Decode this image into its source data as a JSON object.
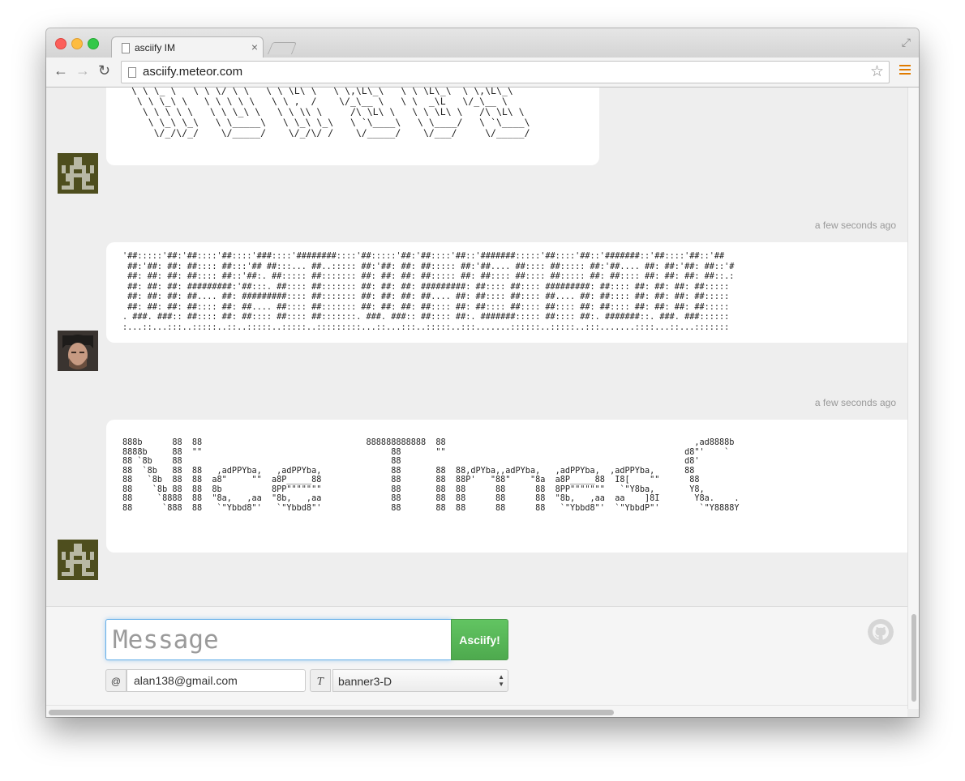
{
  "browser": {
    "tab_title": "asciify IM",
    "tab_close": "×",
    "url": "asciify.meteor.com",
    "back_glyph": "←",
    "forward_glyph": "→",
    "reload_glyph": "↻",
    "star_glyph": "☆",
    "fullscreen_glyph": "⤢",
    "icons": [
      "back-arrow-icon",
      "forward-arrow-icon",
      "reload-icon",
      "page-icon",
      "bookmark-star-icon",
      "chrome-menu-icon"
    ]
  },
  "messages": [
    {
      "avatar": "pixel-robot-avatar",
      "timestamp": "",
      "ascii": " \\ \\ \\_ \\   \\ \\ \\/ \\ \\   \\ \\ \\L\\ \\   \\ \\,\\L\\_\\   \\ \\ \\L\\_\\  \\ \\,\\L\\_\\\n  \\ \\ \\_\\ \\   \\ \\ \\ \\ \\   \\ \\ ,  /    \\/_\\__ \\   \\ \\  _\\L   \\/_\\__ \\\n   \\ \\ \\ \\ \\   \\ \\ \\_\\ \\   \\ \\ \\\\ \\     /\\ \\L\\ \\   \\ \\ \\L\\ \\   /\\ \\L\\ \\\n    \\ \\_\\ \\_\\   \\ \\_____\\   \\ \\_\\ \\_\\   \\ `\\____\\   \\ \\____/   \\ `\\____\\\n     \\/_/\\/_/    \\/_____/    \\/_/\\/ /    \\/_____/    \\/___/     \\/_____/"
    },
    {
      "avatar": "bearded-man-photo-avatar",
      "timestamp": "a few seconds ago",
      "ascii": "'##:::::'##:'##::::'##::::'###::::'########::::'##:::::'##:'##::::'##::'#######:::::'##::::'##::'#######::'##::::'##::'##\n ##:'##: ##: ##:::: ##:::'## ##:::... ##..::::: ##:'##: ##: ##::::: ##:'##.... ##:::: ##::::: ##:'##.... ##: ##:'##: ##::'#\n ##: ##: ##: ##:::: ##::'##:. ##::::: ##::::::: ##: ##: ##: ##::::: ##: ##:::: ##:::: ##::::: ##: ##:::: ##: ##: ##: ##::.:\n ##: ##: ##: #########:'##:::. ##:::: ##::::::: ##: ##: ##: #########: ##:::: ##:::: #########: ##:::: ##: ##: ##: ##:::::\n ##: ##: ##: ##.... ##: #########:::: ##::::::: ##: ##: ##: ##.... ##: ##:::: ##:::: ##.... ##: ##:::: ##: ##: ##: ##:::::\n ##: ##: ##: ##:::: ##: ##.... ##:::: ##::::::: ##: ##: ##: ##:::: ##: ##:::: ##:::: ##:::: ##: ##:::: ##: ##: ##: ##:::::\n. ###. ###:: ##:::: ##: ##:::: ##:::: ##:::::::. ###. ###:: ##:::: ##:. #######::::: ##:::: ##:. #######::. ###. ###::::::\n:...::...:::..:::::..::..:::::..:::::..:::::::::...::...:::..:::::..:::.......::::::..:::::..:::.......::::...::...:::::::"
    },
    {
      "avatar": "pixel-robot-avatar",
      "timestamp": "a few seconds ago",
      "ascii": "888b      88  88                                 888888888888  88                                                  ,ad8888b\n8888b     88  \"\"                                      88       \"\"                                                d8\"'    `\n88 `8b    88                                          88                                                         d8'\n88  `8b   88  88   ,adPPYba,   ,adPPYba,              88       88  88,dPYba,,adPYba,   ,adPPYba,  ,adPPYba,      88\n88   `8b  88  88  a8\"     \"\"  a8P_____88              88       88  88P'   \"88\"    \"8a  a8P_____88  I8[    \"\"      88\n88    `8b 88  88  8b          8PP\"\"\"\"\"\"\"              88       88  88      88      88  8PP\"\"\"\"\"\"\"   `\"Y8ba,       Y8,\n88     `8888  88  \"8a,   ,aa  \"8b,   ,aa              88       88  88      88      88  \"8b,   ,aa  aa    ]8I       Y8a.    .\n88      `888  88   `\"Ybbd8\"'   `\"Ybbd8\"'              88       88  88      88      88   `\"Ybbd8\"'  `\"YbbdP\"'        `\"Y8888Y"
    }
  ],
  "composer": {
    "message_placeholder": "Message",
    "message_value": "",
    "send_label": "Asciify!",
    "email_addon": "@",
    "email_value": "alan138@gmail.com",
    "font_addon": "T",
    "font_selected": "banner3-D",
    "github_icon": "github-icon"
  }
}
